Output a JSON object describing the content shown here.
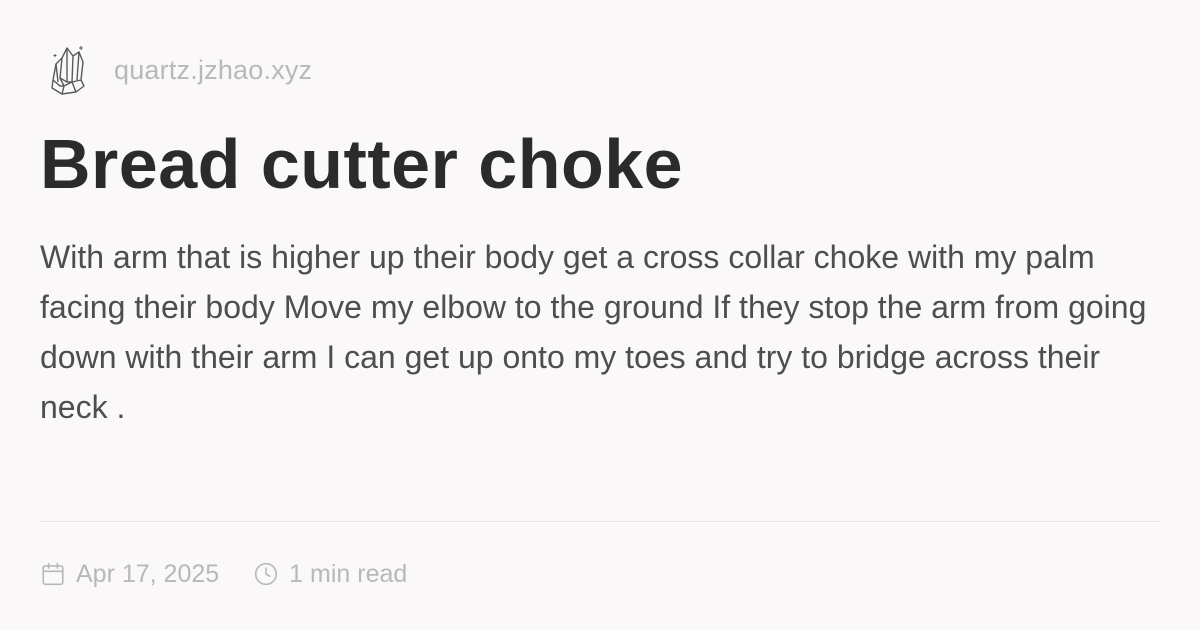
{
  "site": {
    "domain": "quartz.jzhao.xyz",
    "logo_icon": "quartz-crystal-icon"
  },
  "article": {
    "title": "Bread cutter choke",
    "body": "With arm that is higher up their body get a cross collar choke with my palm facing their body Move my elbow to the ground If they stop the arm from going down with their arm I can get up onto my toes and try to bridge across their neck ."
  },
  "meta": {
    "date": "Apr 17, 2025",
    "date_icon": "calendar-icon",
    "read_time": "1 min read",
    "read_time_icon": "clock-icon"
  },
  "colors": {
    "background": "#faf8f8",
    "title": "#2b2b2b",
    "body_text": "#4e4e4e",
    "muted": "#b8b8bb",
    "divider": "#e8e6e6"
  }
}
